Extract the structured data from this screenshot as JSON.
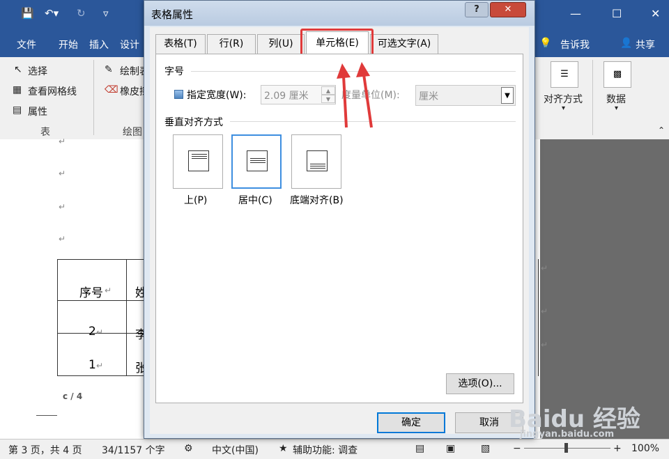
{
  "app": {
    "ribbon_tabs": [
      "文件",
      "开始",
      "插入",
      "设计"
    ],
    "tell_me": "告诉我",
    "share": "共享",
    "ribbon_left": {
      "select": "选择",
      "gridlines": "查看网格线",
      "properties": "属性",
      "group_table": "表"
    },
    "ribbon_draw": {
      "draw": "绘制表",
      "eraser": "橡皮擦",
      "group_draw": "绘图"
    },
    "ribbon_right": {
      "align": "对齐方式",
      "data": "数据"
    }
  },
  "document": {
    "table_header": "序号",
    "row2": "2",
    "row1": "1",
    "col2_row1": "姓",
    "col2_row2": "李",
    "col2_row3": "张",
    "page_marker": "c / 4"
  },
  "status": {
    "page": "第 3 页，共 4 页",
    "words": "34/1157 个字",
    "language": "中文(中国)",
    "accessibility": "辅助功能: 调查",
    "zoom": "100%"
  },
  "dialog": {
    "title": "表格属性",
    "help": "?",
    "close": "✕",
    "tabs": [
      {
        "label": "表格(T)",
        "active": false
      },
      {
        "label": "行(R)",
        "active": false
      },
      {
        "label": "列(U)",
        "active": false
      },
      {
        "label": "单元格(E)",
        "active": true
      },
      {
        "label": "可选文字(A)",
        "active": false
      }
    ],
    "size_section": "字号",
    "specify_width": "指定宽度(W):",
    "width_value": "2.09 厘米",
    "measure_unit": "度量单位(M):",
    "unit_value": "厘米",
    "valign_section": "垂直对齐方式",
    "valign_top": "上(P)",
    "valign_center": "居中(C)",
    "valign_bottom": "底端对齐(B)",
    "options": "选项(O)...",
    "ok": "确定",
    "cancel": "取消"
  },
  "watermark": {
    "text1": "Baidu 经验",
    "text2": "jingyan.baidu.com"
  }
}
